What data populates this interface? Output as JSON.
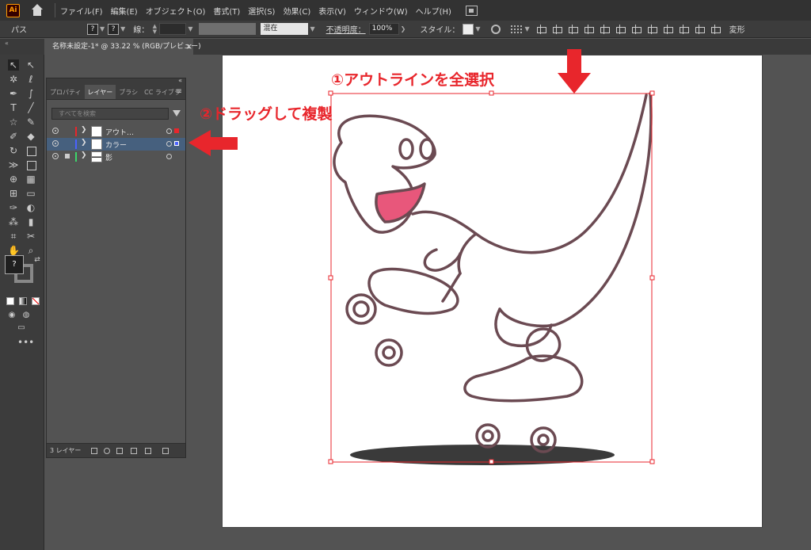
{
  "app": {
    "logo_text": "Ai",
    "menu": [
      "ファイル(F)",
      "編集(E)",
      "オブジェクト(O)",
      "書式(T)",
      "選択(S)",
      "効果(C)",
      "表示(V)",
      "ウィンドウ(W)",
      "ヘルプ(H)"
    ]
  },
  "control_bar": {
    "object_type": "パス",
    "fill_label": "?",
    "stroke_label": "?",
    "stroke_field_label": "線：",
    "blend_mode": "混在",
    "opacity_label": "不透明度：",
    "opacity_value": "100%",
    "style_label": "スタイル：",
    "transform_label": "変形"
  },
  "document_tab": {
    "title": "名称未設定-1* @ 33.22 % (RGB/プレビュー)",
    "close": "×"
  },
  "collapse_label": "«",
  "layers_panel": {
    "collapse": "«",
    "tabs": [
      "プロパティ",
      "レイヤー",
      "ブラシ",
      "CC ライブラ"
    ],
    "active_tab": 1,
    "menu_icon": "≡",
    "search_placeholder": "すべてを検索",
    "layers": [
      {
        "name": "アウト…",
        "color": "#e8262c",
        "selected": false,
        "locked": false
      },
      {
        "name": "カラー",
        "color": "#4a63ff",
        "selected": true,
        "locked": false
      },
      {
        "name": "影",
        "color": "#3cd66b",
        "selected": false,
        "locked": true
      }
    ],
    "footer_count": "3 レイヤー"
  },
  "toolbar": {
    "fill_label": "?",
    "more": "•••"
  },
  "annotations": {
    "step1": "①アウトラインを全選択",
    "step2": "②ドラッグして複製"
  },
  "colors": {
    "annotation": "#e8262c",
    "selection_blue": "#46607e",
    "bbox_red": "#e8262c"
  }
}
